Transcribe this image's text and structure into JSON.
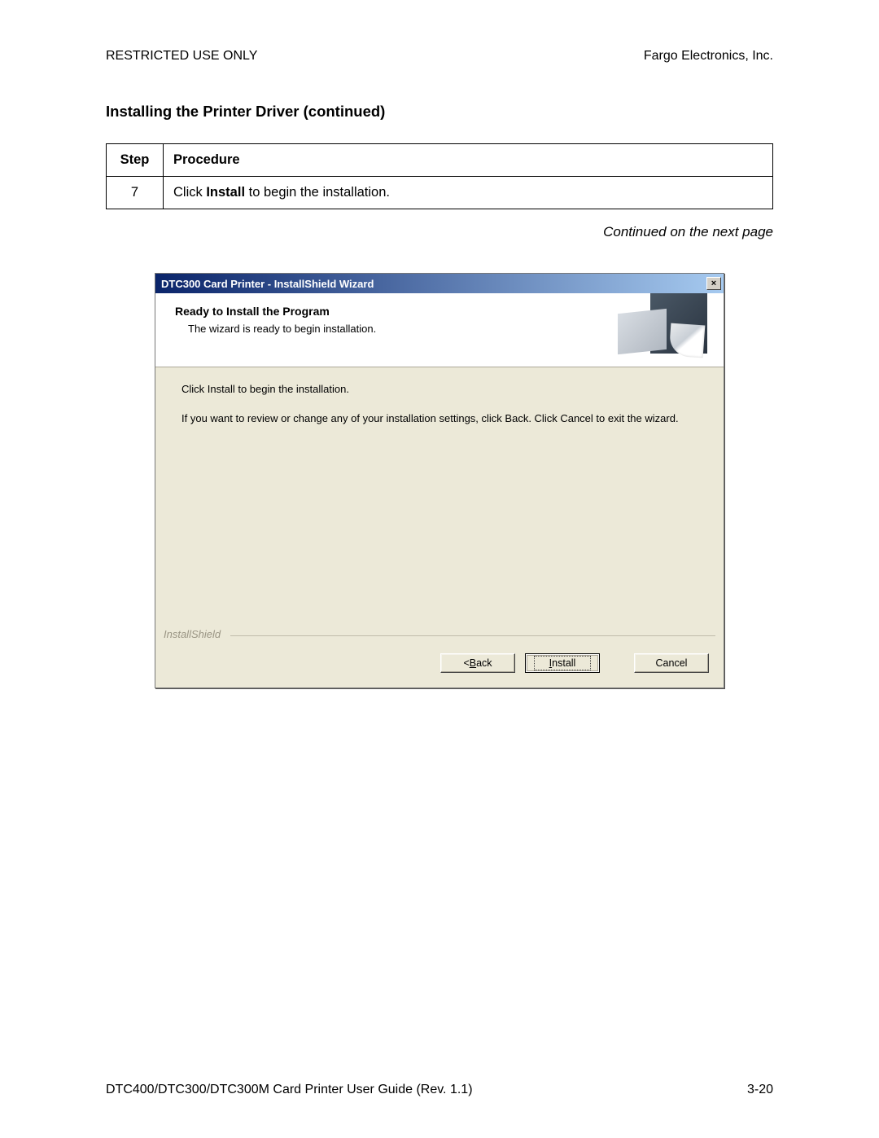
{
  "header": {
    "left": "RESTRICTED USE ONLY",
    "right": "Fargo Electronics, Inc."
  },
  "section_title": "Installing the Printer Driver (continued)",
  "table": {
    "headers": {
      "step": "Step",
      "procedure": "Procedure"
    },
    "rows": [
      {
        "step": "7",
        "pre": "Click ",
        "bold": "Install",
        "post": " to begin the installation."
      }
    ]
  },
  "continued_note": "Continued on the next page",
  "dialog": {
    "title": "DTC300 Card Printer - InstallShield Wizard",
    "close": "×",
    "heading": "Ready to Install the Program",
    "sub": "The wizard is ready to begin installation.",
    "p1": "Click Install to begin the installation.",
    "p2": "If you want to review or change any of your installation settings, click Back. Click Cancel to exit the wizard.",
    "brand": "InstallShield",
    "buttons": {
      "back_pre": "< ",
      "back_u": "B",
      "back_post": "ack",
      "install_u": "I",
      "install_post": "nstall",
      "cancel": "Cancel"
    }
  },
  "footer": {
    "left": "DTC400/DTC300/DTC300M Card Printer User Guide (Rev. 1.1)",
    "right": "3-20"
  }
}
